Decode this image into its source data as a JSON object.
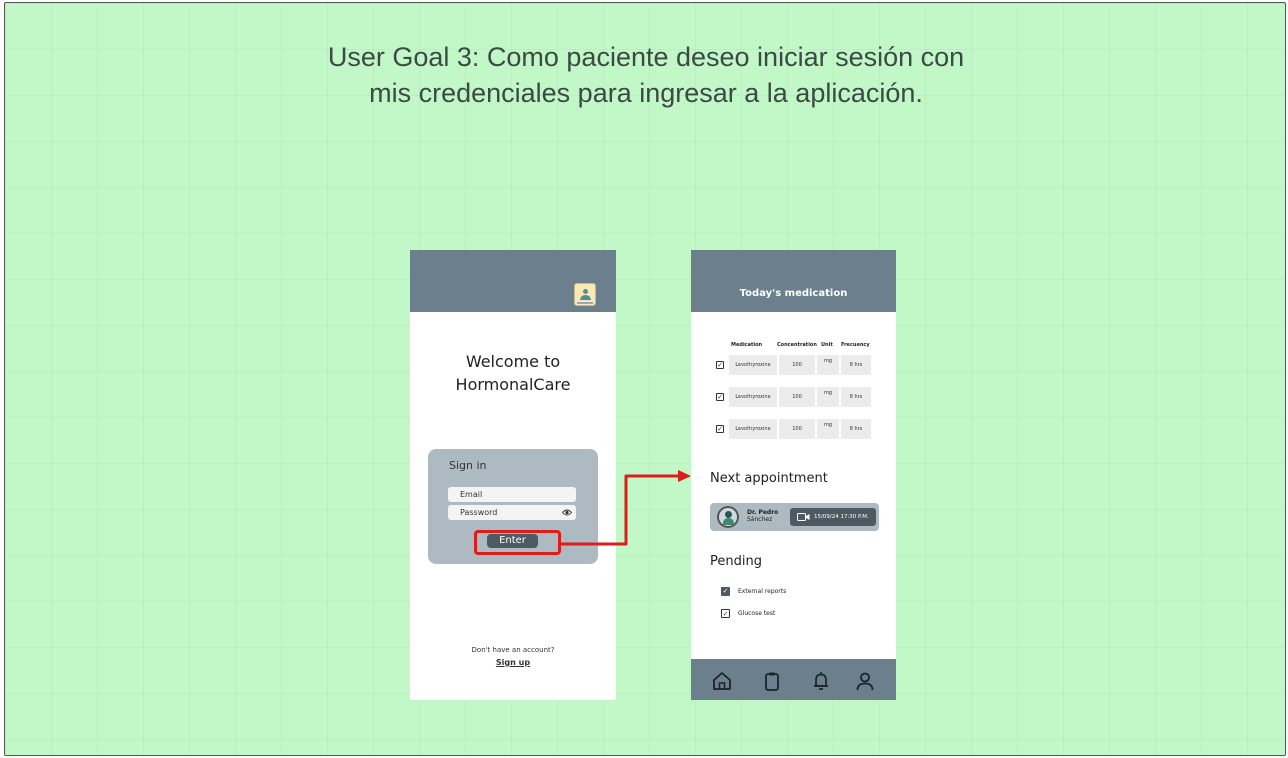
{
  "board": {
    "title_line1": "User Goal 3: Como paciente deseo iniciar sesión con",
    "title_line2": "mis credenciales para ingresar a la aplicación."
  },
  "colors": {
    "board_background": "#c2f7c7",
    "header": "#6b808c",
    "panel": "#aebac1",
    "button": "#4d5a62",
    "highlight": "#dd1c1c"
  },
  "login_screen": {
    "logo_icon": "app-logo-icon",
    "welcome_line1": "Welcome to",
    "welcome_line2": "HormonalCare",
    "signin_heading": "Sign in",
    "email_placeholder": "Email",
    "password_placeholder": "Password",
    "password_toggle_icon": "eye-icon",
    "enter_label": "Enter",
    "no_account_text": "Don't have an account?",
    "signup_label": "Sign up"
  },
  "home_screen": {
    "title": "Today's medication",
    "table_headers": {
      "medication": "Medication",
      "concentration": "Concentration",
      "unit": "Unit",
      "frequency": "Frecuency"
    },
    "medications": [
      {
        "checked": true,
        "name": "Levothyroxine",
        "concentration": "100",
        "unit": "mg",
        "frequency": "8 hrs"
      },
      {
        "checked": true,
        "name": "Levothyroxine",
        "concentration": "100",
        "unit": "mg",
        "frequency": "8 hrs"
      },
      {
        "checked": true,
        "name": "Levothyroxine",
        "concentration": "100",
        "unit": "mg",
        "frequency": "8 hrs"
      }
    ],
    "next_appointment_heading": "Next appointment",
    "appointment": {
      "doctor_line1": "Dr. Pedro",
      "doctor_line2": "Sánchez",
      "datetime": "15/09/24 17:30 P.M.",
      "icon": "video-camera-icon"
    },
    "pending_heading": "Pending",
    "pending_items": [
      {
        "label": "External reports",
        "checked": true
      },
      {
        "label": "Glucose test",
        "checked": true
      }
    ],
    "bottom_nav": [
      "home-icon",
      "clipboard-icon",
      "bell-icon",
      "user-icon"
    ]
  }
}
